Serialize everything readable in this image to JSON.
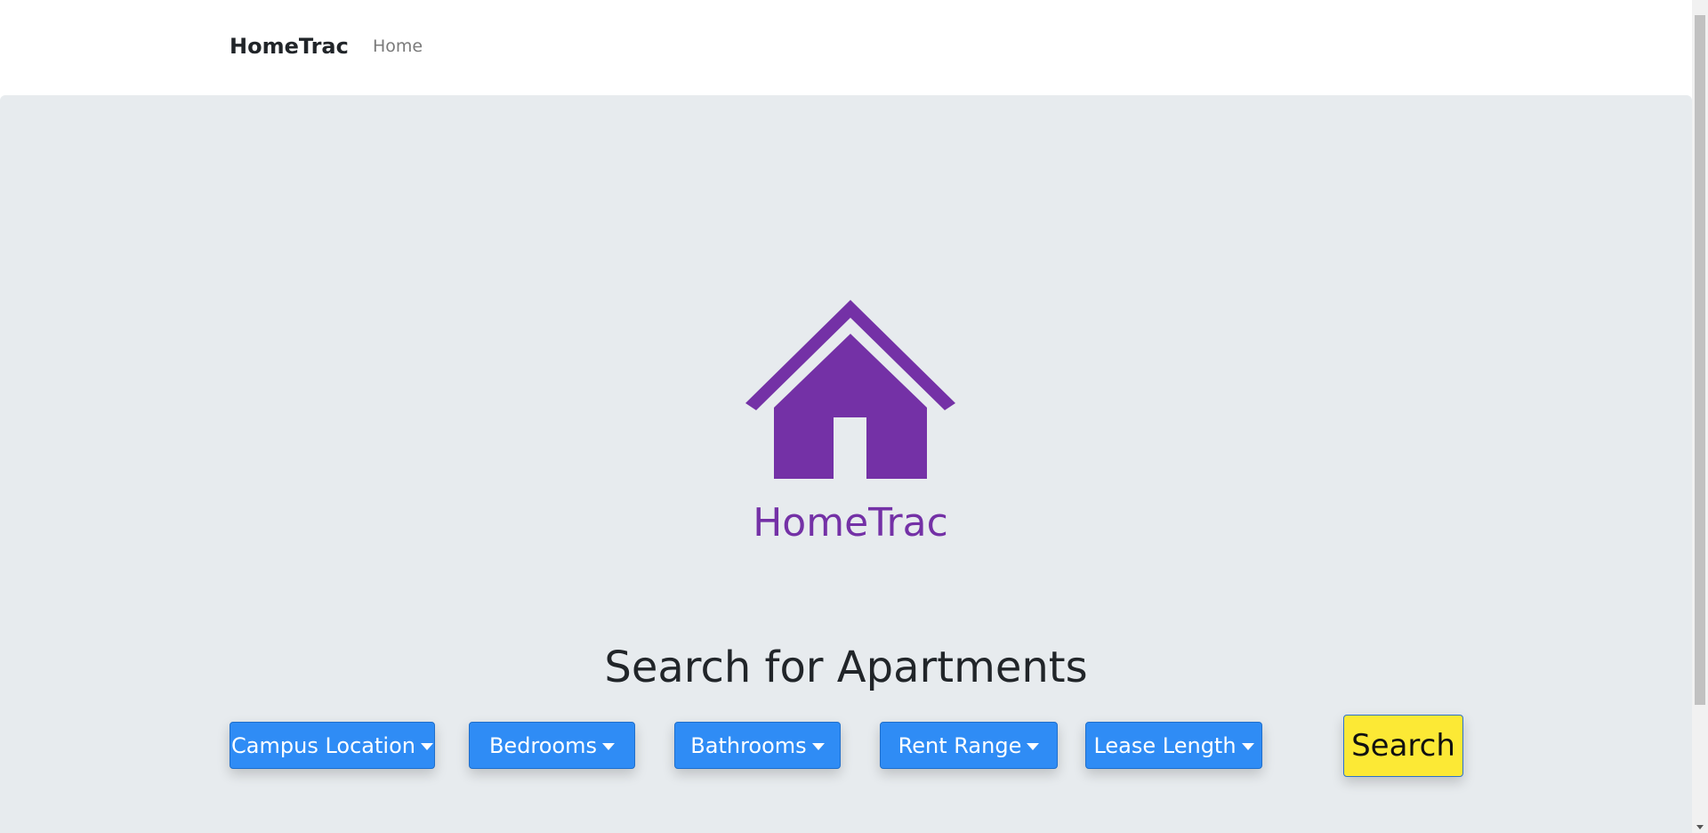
{
  "navbar": {
    "brand": "HomeTrac",
    "links": [
      {
        "label": "Home"
      }
    ]
  },
  "hero": {
    "logo_icon": "house-icon",
    "logo_text": "HomeTrac",
    "logo_color": "#7431a6",
    "heading": "Search for Apartments"
  },
  "filters": [
    {
      "label": "Campus Location"
    },
    {
      "label": "Bedrooms"
    },
    {
      "label": "Bathrooms"
    },
    {
      "label": "Rent Range"
    },
    {
      "label": "Lease Length"
    }
  ],
  "search_button": {
    "label": "Search"
  },
  "colors": {
    "accent": "#2f8cf5",
    "search": "#fce935",
    "background": "#e7ebee"
  }
}
